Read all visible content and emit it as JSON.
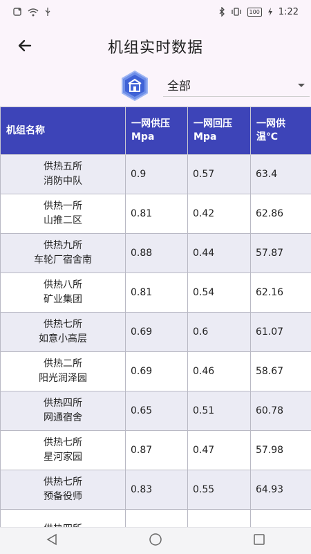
{
  "status_bar": {
    "time": "1:22",
    "battery": "100"
  },
  "header": {
    "title": "机组实时数据"
  },
  "filter": {
    "selected": "全部"
  },
  "table": {
    "columns": [
      "机组名称",
      "一网供压\nMpa",
      "一网回压\nMpa",
      "一网供\n温℃"
    ],
    "rows": [
      {
        "line1": "供热五所",
        "line2": "消防中队",
        "supply_pressure": "0.9",
        "return_pressure": "0.57",
        "supply_temp": "63.4"
      },
      {
        "line1": "供热一所",
        "line2": "山推二区",
        "supply_pressure": "0.81",
        "return_pressure": "0.42",
        "supply_temp": "62.86"
      },
      {
        "line1": "供热九所",
        "line2": "车轮厂宿舍南",
        "supply_pressure": "0.88",
        "return_pressure": "0.44",
        "supply_temp": "57.87"
      },
      {
        "line1": "供热八所",
        "line2": "矿业集团",
        "supply_pressure": "0.81",
        "return_pressure": "0.54",
        "supply_temp": "62.16"
      },
      {
        "line1": "供热七所",
        "line2": "如意小高层",
        "supply_pressure": "0.69",
        "return_pressure": "0.6",
        "supply_temp": "61.07"
      },
      {
        "line1": "供热二所",
        "line2": "阳光润泽园",
        "supply_pressure": "0.69",
        "return_pressure": "0.46",
        "supply_temp": "58.67"
      },
      {
        "line1": "供热四所",
        "line2": "网通宿舍",
        "supply_pressure": "0.65",
        "return_pressure": "0.51",
        "supply_temp": "60.78"
      },
      {
        "line1": "供热七所",
        "line2": "星河家园",
        "supply_pressure": "0.87",
        "return_pressure": "0.47",
        "supply_temp": "57.98"
      },
      {
        "line1": "供热七所",
        "line2": "预备役师",
        "supply_pressure": "0.83",
        "return_pressure": "0.55",
        "supply_temp": "64.93"
      },
      {
        "line1": "供热四所",
        "line2": "",
        "supply_pressure": "",
        "return_pressure": "",
        "supply_temp": ""
      }
    ]
  },
  "icons": {
    "back": "arrow-left-icon",
    "filter": "building-hexagon-icon",
    "dropdown": "caret-down-icon"
  },
  "colors": {
    "header_bg": "#3d44b8",
    "alt_row": "#ebebf4",
    "app_bar": "#fbf4fb"
  }
}
